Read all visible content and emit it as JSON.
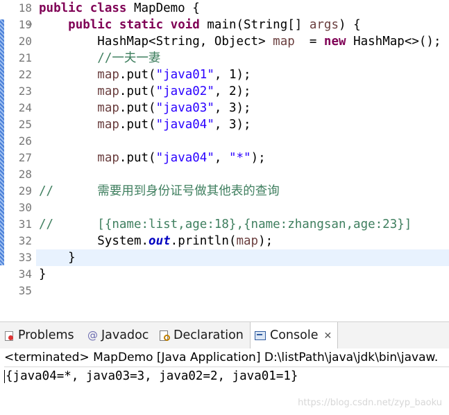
{
  "editor": {
    "lines": [
      {
        "num": "18",
        "segs": [
          {
            "t": "public class ",
            "c": "kw"
          },
          {
            "t": "MapDemo {",
            "c": ""
          }
        ]
      },
      {
        "num": "19",
        "fold": "⊖",
        "segs": [
          {
            "t": "    ",
            "c": ""
          },
          {
            "t": "public static void ",
            "c": "kw"
          },
          {
            "t": "main(String[] ",
            "c": ""
          },
          {
            "t": "args",
            "c": "var"
          },
          {
            "t": ") {",
            "c": ""
          }
        ]
      },
      {
        "num": "20",
        "segs": [
          {
            "t": "        HashMap<String, Object> ",
            "c": ""
          },
          {
            "t": "map",
            "c": "var"
          },
          {
            "t": "  = ",
            "c": ""
          },
          {
            "t": "new ",
            "c": "kw"
          },
          {
            "t": "HashMap<>();",
            "c": ""
          }
        ]
      },
      {
        "num": "21",
        "segs": [
          {
            "t": "        ",
            "c": ""
          },
          {
            "t": "//一夫一妻",
            "c": "cm"
          }
        ]
      },
      {
        "num": "22",
        "segs": [
          {
            "t": "        ",
            "c": ""
          },
          {
            "t": "map",
            "c": "var"
          },
          {
            "t": ".put(",
            "c": ""
          },
          {
            "t": "\"java01\"",
            "c": "str"
          },
          {
            "t": ", 1);",
            "c": ""
          }
        ]
      },
      {
        "num": "23",
        "segs": [
          {
            "t": "        ",
            "c": ""
          },
          {
            "t": "map",
            "c": "var"
          },
          {
            "t": ".put(",
            "c": ""
          },
          {
            "t": "\"java02\"",
            "c": "str"
          },
          {
            "t": ", 2);",
            "c": ""
          }
        ]
      },
      {
        "num": "24",
        "segs": [
          {
            "t": "        ",
            "c": ""
          },
          {
            "t": "map",
            "c": "var"
          },
          {
            "t": ".put(",
            "c": ""
          },
          {
            "t": "\"java03\"",
            "c": "str"
          },
          {
            "t": ", 3);",
            "c": ""
          }
        ]
      },
      {
        "num": "25",
        "segs": [
          {
            "t": "        ",
            "c": ""
          },
          {
            "t": "map",
            "c": "var"
          },
          {
            "t": ".put(",
            "c": ""
          },
          {
            "t": "\"java04\"",
            "c": "str"
          },
          {
            "t": ", 3);",
            "c": ""
          }
        ]
      },
      {
        "num": "26",
        "segs": []
      },
      {
        "num": "27",
        "segs": [
          {
            "t": "        ",
            "c": ""
          },
          {
            "t": "map",
            "c": "var"
          },
          {
            "t": ".put(",
            "c": ""
          },
          {
            "t": "\"java04\"",
            "c": "str"
          },
          {
            "t": ", ",
            "c": ""
          },
          {
            "t": "\"*\"",
            "c": "str"
          },
          {
            "t": ");",
            "c": ""
          }
        ]
      },
      {
        "num": "28",
        "segs": []
      },
      {
        "num": "29",
        "segs": [
          {
            "t": "//      需要用到身份证号做其他表的查询",
            "c": "cm"
          }
        ]
      },
      {
        "num": "30",
        "segs": []
      },
      {
        "num": "31",
        "segs": [
          {
            "t": "//      [{name:list,age:18},{name:zhangsan,age:23}]",
            "c": "cm"
          }
        ]
      },
      {
        "num": "32",
        "segs": [
          {
            "t": "        System.",
            "c": ""
          },
          {
            "t": "out",
            "c": "fld"
          },
          {
            "t": ".println(",
            "c": ""
          },
          {
            "t": "map",
            "c": "var"
          },
          {
            "t": ");",
            "c": ""
          }
        ]
      },
      {
        "num": "33",
        "current": true,
        "segs": [
          {
            "t": "    }",
            "c": ""
          }
        ]
      },
      {
        "num": "34",
        "segs": [
          {
            "t": "}",
            "c": ""
          }
        ]
      },
      {
        "num": "35",
        "segs": []
      }
    ],
    "scroll_left_glyph": "<"
  },
  "tabs": {
    "problems": "Problems",
    "javadoc_icon": "@",
    "javadoc": "Javadoc",
    "declaration": "Declaration",
    "console": "Console",
    "close_glyph": "✕"
  },
  "console": {
    "status": "<terminated> MapDemo [Java Application] D:\\listPath\\java\\jdk\\bin\\javaw.",
    "output": "{java04=*, java03=3, java02=2, java01=1}"
  },
  "watermark": "https://blog.csdn.net/zyp_baoku",
  "colors": {
    "keyword": "#7f0055",
    "string": "#2a00ff",
    "comment": "#3f7f5f",
    "local_variable": "#6a3e3e",
    "static_field": "#0000c0",
    "current_line": "#e8f2fe"
  },
  "icons": {
    "problems": "problems-icon",
    "javadoc": "javadoc-icon",
    "declaration": "declaration-icon",
    "console": "console-icon",
    "fold": "collapse-icon",
    "close": "close-icon"
  }
}
